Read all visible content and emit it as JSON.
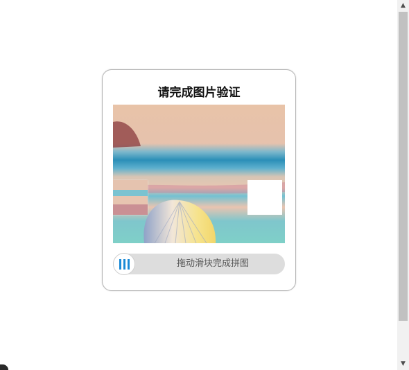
{
  "captcha": {
    "title": "请完成图片验证",
    "slider_hint": "拖动滑块完成拼图",
    "image": {
      "description_icon": "beach-seashell-image",
      "accent": "#1a8ad6"
    }
  },
  "colors": {
    "slider_track": "#dddddd",
    "handle_grip": "#1a8ad6",
    "scroll_thumb": "#c1c1c1"
  }
}
